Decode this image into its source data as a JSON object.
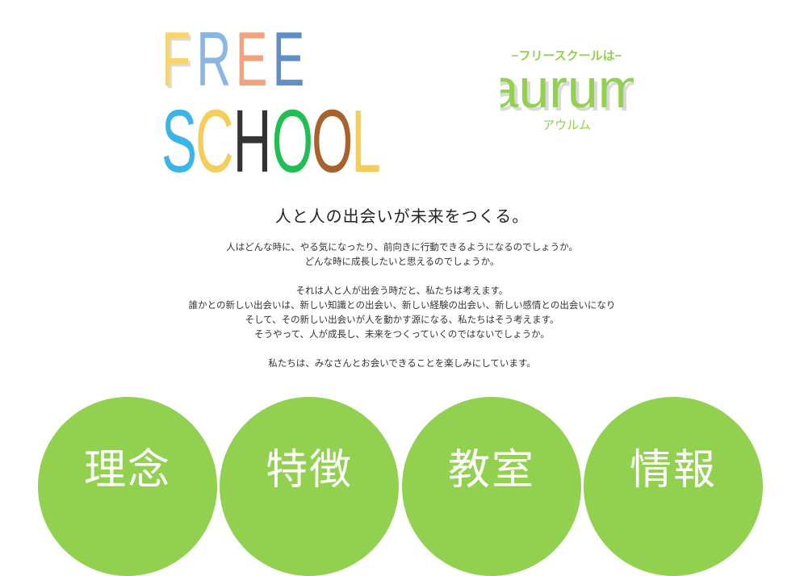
{
  "logo": {
    "free_letters": [
      "F",
      "R",
      "E",
      "E"
    ],
    "school_letters": [
      "S",
      "C",
      "H",
      "O",
      "O",
      "L"
    ],
    "colors": {
      "free": [
        "#f8d56b",
        "#8bb6e2",
        "#f2a37c",
        "#5f8fc4"
      ],
      "school": [
        "#3bb4ea",
        "#f5cd5a",
        "#333333",
        "#1fbf55",
        "#a8622a",
        "#f5cd5a"
      ]
    }
  },
  "brand": {
    "tagline_small": "−フリースクールは−",
    "name": "aurum",
    "name_kana": "アウルム",
    "accent": "#92d050"
  },
  "headline": "人と人の出会いが未来をつくる。",
  "paragraphs": {
    "p1": "人はどんな時に、やる気になったり、前向きに行動できるようになるのでしょうか。",
    "p2": "どんな時に成長したいと思えるのでしょうか。",
    "p3": "それは人と人が出会う時だと、私たちは考えます。",
    "p4": "誰かとの新しい出会いは、新しい知識との出会い、新しい経験の出会い、新しい感情との出会いになり",
    "p5": "そして、その新しい出会いが人を動かす源になる、私たちはそう考えます。",
    "p6": "そうやって、人が成長し、未来をつくっていくのではないでしょうか。",
    "p7": "私たちは、みなさんとお会いできることを楽しみにしています。"
  },
  "nav": {
    "item1": "理念",
    "item2": "特徴",
    "item3": "教室",
    "item4": "情報"
  }
}
